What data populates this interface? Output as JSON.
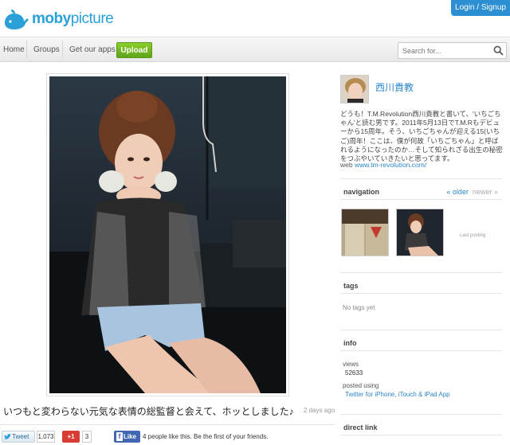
{
  "brand": {
    "logo_bold": "moby",
    "logo_light": "picture",
    "accent": "#2a9fd8"
  },
  "header": {
    "login_label": "Login / Signup"
  },
  "nav": {
    "items": [
      "Home",
      "Groups",
      "Get our apps"
    ],
    "upload_label": "Upload",
    "search_placeholder": "Search for..."
  },
  "photo": {
    "caption": "いつもと変わらない元気な表情の総監督と会えて、ホッとしました♪",
    "time_ago": "2 days ago"
  },
  "share": {
    "tweet_label": "Tweet",
    "tweet_count": "1,073",
    "gplus_label": "+1",
    "gplus_count": "3",
    "like_label": "Like",
    "like_text": "4 people like this. Be the first of your friends."
  },
  "user": {
    "name": "西川貴教",
    "bio": "どうも！T.M.Revolution西川貴教と書いて、'いちごちゃん'と読む男です。2011年5月13日でT.M.Rもデビューから15周年。そう、いちごちゃんが迎える15(いちご)周年！ここは、僕が何故「いちごちゃん」と呼ばれるようになったのか…そして知られざる出生の秘密をつぶやいていきたいと思ってます。",
    "web_label": "web",
    "web_url": "www.tm-revolution.com/"
  },
  "sidebar": {
    "navigation_title": "navigation",
    "older_label": "« older",
    "newer_label": "newer »",
    "last_posting": "Last posting",
    "tags_title": "tags",
    "no_tags": "No tags yet",
    "info_title": "info",
    "views_label": "views",
    "views_value": "52633",
    "posted_using_label": "posted using",
    "posted_using_value": "Twitter for iPhone, iTouch & iPad App",
    "direct_link_title": "direct link"
  }
}
